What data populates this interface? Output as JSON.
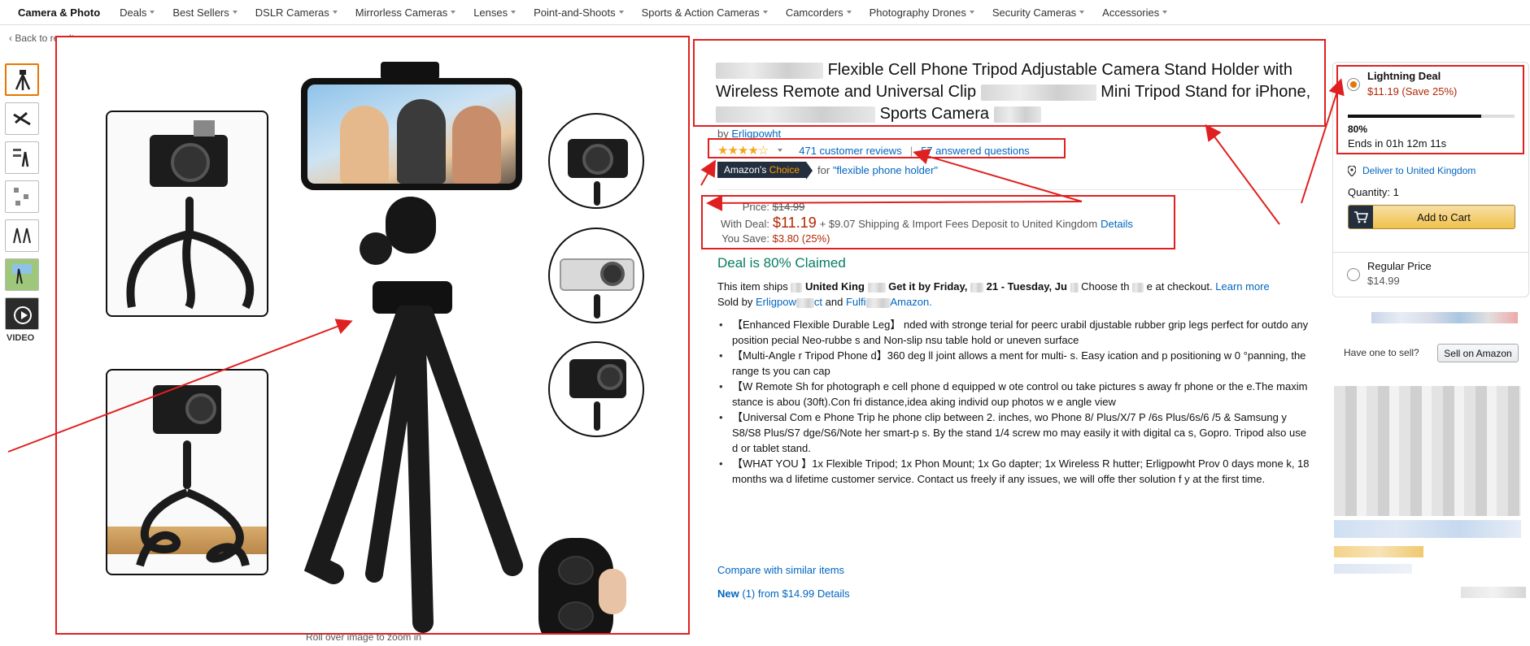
{
  "nav": {
    "brand": "Camera & Photo",
    "categories": [
      "Deals",
      "Best Sellers",
      "DSLR Cameras",
      "Mirrorless Cameras",
      "Lenses",
      "Point-and-Shoots",
      "Sports & Action Cameras",
      "Camcorders",
      "Photography Drones",
      "Security Cameras",
      "Accessories"
    ]
  },
  "back_link": "‹ Back to results",
  "gallery": {
    "video_label": "VIDEO",
    "zoom_hint": "Roll over image to zoom in"
  },
  "product": {
    "title_part1": "Flexible Cell Phone Tripod Adjustable Camera Stand Holder",
    "title_part2": "with Wireless Remote and Universal Clip",
    "title_part3": "Mini Tripod Stand for",
    "title_part4": "iPhone,",
    "title_part5": "Sports Camera",
    "by_prefix": "by",
    "brand": "Erligpowht",
    "rating": 4.5,
    "reviews_link": "471 customer reviews",
    "questions_link": "57 answered questions",
    "choice_badge_1": "Amazon's",
    "choice_badge_2": "Choice",
    "choice_for": "for",
    "choice_query": "\"flexible phone holder\""
  },
  "pricing": {
    "price_label": "Price:",
    "list_price": "$14.99",
    "deal_label": "With Deal:",
    "deal_price": "$11.19",
    "shipping": "+ $9.07 Shipping & Import Fees Deposit to United Kingdom",
    "details_link": "Details",
    "save_label": "You Save:",
    "save_value": "$3.80 (25%)"
  },
  "deal_claimed": "Deal is 80% Claimed",
  "shipping_info": {
    "line1_a": "This item ships",
    "line1_b": "United King",
    "line1_c": "Get it by Friday,",
    "line1_d": "21 - Tuesday, Ju",
    "line1_e": "Choose th",
    "line1_f": "e at checkout.",
    "learn_more": "Learn more",
    "sold_by": "Sold by",
    "seller": "Erligpow",
    "seller_tail": "ct",
    "and": "and",
    "fulfilled": "Fulfi",
    "fulfilled_tail": "Amazon."
  },
  "bullets": [
    "【Enhanced Flexible      Durable Leg】   nded with stronge   terial for peerc    urabil   djustable rubber grip legs   perfect for outdo    any position   pecial Neo-rubbe     s and Non-slip     nsu    table hold or uneven surface",
    "【Multi-Angle        r Tripod Phone      d】360 deg      ll joint allows a       ment for multi-              s.  Easy             ication and p        positioning w        0 °panning,          the range           ts you can cap",
    "【W        Remote Sh       for photograph       e cell phone       d equipped w      ote control           ou take pictures      s away fr       phone or the         e.The maxim       stance is abou      (30ft).Con          fri distance,idea      aking individ        oup photos w        e angle view",
    "【Universal Com        e Phone Trip      he phone clip          between 2.        inches, wo       Phone 8/     Plus/X/7 P      /6s Plus/6s/6       /5 & Samsung       y S8/S8 Plus/S7        dge/S6/Note      her smart-p       s. By the stand      1/4 screw mo        may easily         it with digital ca      s, Gopro. Tripod       also use      d or tablet stand.",
    "【WHAT YOU      】1x Flexible       Tripod; 1x Phon      Mount; 1x Go      dapter; 1x Wireless R        hutter; Erligpowht Prov       0 days mone     k, 18 months wa        d lifetime customer service. Contact us freely if any issues, we will offe    ther solution f      y at the first time."
  ],
  "compare_link": "Compare with similar items",
  "new_from": {
    "prefix": "New",
    "count": "(1)",
    "rest": "from $14.99",
    "details": "Details"
  },
  "buybox": {
    "deal_title": "Lightning Deal",
    "deal_price": "$11.19 (Save 25%)",
    "claimed_fraction": 0.8,
    "claimed_pct": "80%",
    "ends_in": "Ends in 01h 12m 11s",
    "deliver": "Deliver to United Kingdom",
    "quantity": "Quantity: 1",
    "add_to_cart": "Add to Cart",
    "regular_title": "Regular Price",
    "regular_price": "$14.99"
  },
  "sell": {
    "question": "Have one to sell?",
    "button": "Sell on Amazon"
  },
  "colors": {
    "price_red": "#b12704",
    "link_blue": "#0066c0",
    "deal_green": "#067d62",
    "annotation_red": "#e02020",
    "amazon_orange": "#ff9900"
  }
}
